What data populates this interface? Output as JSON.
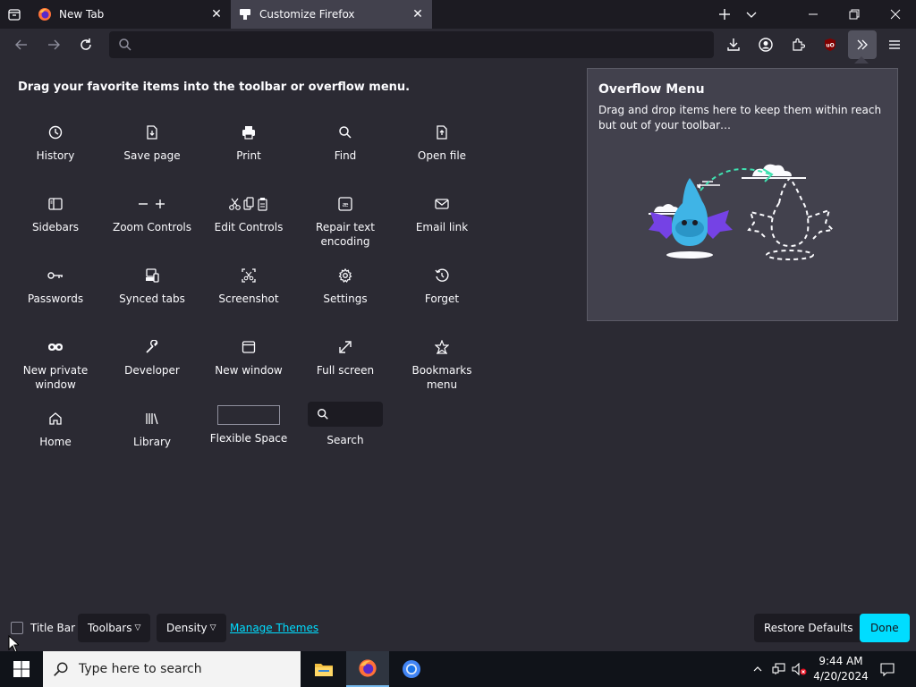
{
  "tabs": [
    {
      "title": "New Tab",
      "favicon": "firefox-icon",
      "active": false
    },
    {
      "title": "Customize Firefox",
      "favicon": "customize-icon",
      "active": true
    }
  ],
  "toolbar": {
    "url_placeholder": "",
    "icons": [
      "back-icon",
      "forward-icon",
      "reload-icon",
      "search-icon",
      "downloads-icon",
      "account-icon",
      "extensions-icon",
      "ublock-icon",
      "overflow-chevron-icon",
      "hamburger-menu-icon"
    ]
  },
  "customize": {
    "heading": "Drag your favorite items into the toolbar or overflow menu.",
    "items": [
      {
        "label": "History",
        "icon": "history-icon"
      },
      {
        "label": "Save page",
        "icon": "save-page-icon"
      },
      {
        "label": "Print",
        "icon": "print-icon"
      },
      {
        "label": "Find",
        "icon": "find-icon"
      },
      {
        "label": "Open file",
        "icon": "open-file-icon"
      },
      {
        "label": "Sidebars",
        "icon": "sidebars-icon"
      },
      {
        "label": "Zoom Controls",
        "icon": "zoom-icon"
      },
      {
        "label": "Edit Controls",
        "icon": "edit-icon"
      },
      {
        "label": "Repair text encoding",
        "icon": "text-encoding-icon"
      },
      {
        "label": "Email link",
        "icon": "email-icon"
      },
      {
        "label": "Passwords",
        "icon": "key-icon"
      },
      {
        "label": "Synced tabs",
        "icon": "synced-tabs-icon"
      },
      {
        "label": "Screenshot",
        "icon": "screenshot-icon"
      },
      {
        "label": "Settings",
        "icon": "gear-icon"
      },
      {
        "label": "Forget",
        "icon": "forget-icon"
      },
      {
        "label": "New private window",
        "icon": "private-mask-icon"
      },
      {
        "label": "Developer",
        "icon": "wrench-icon"
      },
      {
        "label": "New window",
        "icon": "window-icon"
      },
      {
        "label": "Full screen",
        "icon": "fullscreen-icon"
      },
      {
        "label": "Bookmarks menu",
        "icon": "bookmark-star-icon"
      },
      {
        "label": "Home",
        "icon": "home-icon"
      },
      {
        "label": "Library",
        "icon": "library-icon"
      },
      {
        "label": "Flexible Space",
        "icon": "flexible-space"
      },
      {
        "label": "Search",
        "icon": "search-icon"
      }
    ]
  },
  "overflow_panel": {
    "title": "Overflow Menu",
    "description": "Drag and drop items here to keep them within reach but out of your toolbar…"
  },
  "footer": {
    "title_bar_label": "Title Bar",
    "toolbars_label": "Toolbars",
    "density_label": "Density",
    "manage_themes_label": "Manage Themes",
    "restore_defaults_label": "Restore Defaults",
    "done_label": "Done"
  },
  "taskbar": {
    "search_placeholder": "Type here to search",
    "time": "9:44 AM",
    "date": "4/20/2024"
  },
  "colors": {
    "accent": "#00ddff",
    "toolbar_bg": "#2b2a33",
    "tab_bg": "#1c1b22",
    "panel_bg": "#42414d"
  }
}
